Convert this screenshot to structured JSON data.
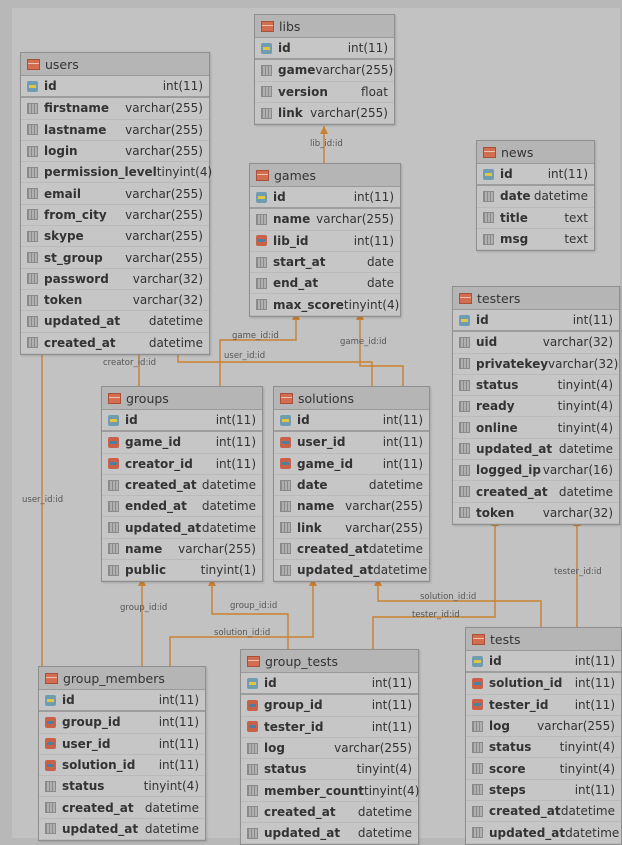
{
  "tables": [
    {
      "id": "users",
      "name": "users",
      "columns": [
        {
          "name": "id",
          "type": "int(11)",
          "key": "pk"
        },
        {
          "name": "firstname",
          "type": "varchar(255)",
          "key": ""
        },
        {
          "name": "lastname",
          "type": "varchar(255)",
          "key": ""
        },
        {
          "name": "login",
          "type": "varchar(255)",
          "key": ""
        },
        {
          "name": "permission_level",
          "type": "tinyint(4)",
          "key": ""
        },
        {
          "name": "email",
          "type": "varchar(255)",
          "key": ""
        },
        {
          "name": "from_city",
          "type": "varchar(255)",
          "key": ""
        },
        {
          "name": "skype",
          "type": "varchar(255)",
          "key": ""
        },
        {
          "name": "st_group",
          "type": "varchar(255)",
          "key": ""
        },
        {
          "name": "password",
          "type": "varchar(32)",
          "key": ""
        },
        {
          "name": "token",
          "type": "varchar(32)",
          "key": ""
        },
        {
          "name": "updated_at",
          "type": "datetime",
          "key": ""
        },
        {
          "name": "created_at",
          "type": "datetime",
          "key": ""
        }
      ]
    },
    {
      "id": "libs",
      "name": "libs",
      "columns": [
        {
          "name": "id",
          "type": "int(11)",
          "key": "pk"
        },
        {
          "name": "game",
          "type": "varchar(255)",
          "key": ""
        },
        {
          "name": "version",
          "type": "float",
          "key": ""
        },
        {
          "name": "link",
          "type": "varchar(255)",
          "key": ""
        }
      ]
    },
    {
      "id": "news",
      "name": "news",
      "columns": [
        {
          "name": "id",
          "type": "int(11)",
          "key": "pk"
        },
        {
          "name": "date",
          "type": "datetime",
          "key": ""
        },
        {
          "name": "title",
          "type": "text",
          "key": ""
        },
        {
          "name": "msg",
          "type": "text",
          "key": ""
        }
      ]
    },
    {
      "id": "games",
      "name": "games",
      "columns": [
        {
          "name": "id",
          "type": "int(11)",
          "key": "pk"
        },
        {
          "name": "name",
          "type": "varchar(255)",
          "key": ""
        },
        {
          "name": "lib_id",
          "type": "int(11)",
          "key": "fk"
        },
        {
          "name": "start_at",
          "type": "date",
          "key": ""
        },
        {
          "name": "end_at",
          "type": "date",
          "key": ""
        },
        {
          "name": "max_score",
          "type": "tinyint(4)",
          "key": ""
        }
      ]
    },
    {
      "id": "testers",
      "name": "testers",
      "columns": [
        {
          "name": "id",
          "type": "int(11)",
          "key": "pk"
        },
        {
          "name": "uid",
          "type": "varchar(32)",
          "key": ""
        },
        {
          "name": "privatekey",
          "type": "varchar(32)",
          "key": ""
        },
        {
          "name": "status",
          "type": "tinyint(4)",
          "key": ""
        },
        {
          "name": "ready",
          "type": "tinyint(4)",
          "key": ""
        },
        {
          "name": "online",
          "type": "tinyint(4)",
          "key": ""
        },
        {
          "name": "updated_at",
          "type": "datetime",
          "key": ""
        },
        {
          "name": "logged_ip",
          "type": "varchar(16)",
          "key": ""
        },
        {
          "name": "created_at",
          "type": "datetime",
          "key": ""
        },
        {
          "name": "token",
          "type": "varchar(32)",
          "key": ""
        }
      ]
    },
    {
      "id": "groups",
      "name": "groups",
      "columns": [
        {
          "name": "id",
          "type": "int(11)",
          "key": "pk"
        },
        {
          "name": "game_id",
          "type": "int(11)",
          "key": "fk"
        },
        {
          "name": "creator_id",
          "type": "int(11)",
          "key": "fk"
        },
        {
          "name": "created_at",
          "type": "datetime",
          "key": ""
        },
        {
          "name": "ended_at",
          "type": "datetime",
          "key": ""
        },
        {
          "name": "updated_at",
          "type": "datetime",
          "key": ""
        },
        {
          "name": "name",
          "type": "varchar(255)",
          "key": ""
        },
        {
          "name": "public",
          "type": "tinyint(1)",
          "key": ""
        }
      ]
    },
    {
      "id": "solutions",
      "name": "solutions",
      "columns": [
        {
          "name": "id",
          "type": "int(11)",
          "key": "pk"
        },
        {
          "name": "user_id",
          "type": "int(11)",
          "key": "fk"
        },
        {
          "name": "game_id",
          "type": "int(11)",
          "key": "fk"
        },
        {
          "name": "date",
          "type": "datetime",
          "key": ""
        },
        {
          "name": "name",
          "type": "varchar(255)",
          "key": ""
        },
        {
          "name": "link",
          "type": "varchar(255)",
          "key": ""
        },
        {
          "name": "created_at",
          "type": "datetime",
          "key": ""
        },
        {
          "name": "updated_at",
          "type": "datetime",
          "key": ""
        }
      ]
    },
    {
      "id": "group_members",
      "name": "group_members",
      "columns": [
        {
          "name": "id",
          "type": "int(11)",
          "key": "pk"
        },
        {
          "name": "group_id",
          "type": "int(11)",
          "key": "fk"
        },
        {
          "name": "user_id",
          "type": "int(11)",
          "key": "fk"
        },
        {
          "name": "solution_id",
          "type": "int(11)",
          "key": "fk"
        },
        {
          "name": "status",
          "type": "tinyint(4)",
          "key": ""
        },
        {
          "name": "created_at",
          "type": "datetime",
          "key": ""
        },
        {
          "name": "updated_at",
          "type": "datetime",
          "key": ""
        }
      ]
    },
    {
      "id": "group_tests",
      "name": "group_tests",
      "columns": [
        {
          "name": "id",
          "type": "int(11)",
          "key": "pk"
        },
        {
          "name": "group_id",
          "type": "int(11)",
          "key": "fk"
        },
        {
          "name": "tester_id",
          "type": "int(11)",
          "key": "fk"
        },
        {
          "name": "log",
          "type": "varchar(255)",
          "key": ""
        },
        {
          "name": "status",
          "type": "tinyint(4)",
          "key": ""
        },
        {
          "name": "member_count",
          "type": "tinyint(4)",
          "key": ""
        },
        {
          "name": "created_at",
          "type": "datetime",
          "key": ""
        },
        {
          "name": "updated_at",
          "type": "datetime",
          "key": ""
        }
      ]
    },
    {
      "id": "tests",
      "name": "tests",
      "columns": [
        {
          "name": "id",
          "type": "int(11)",
          "key": "pk"
        },
        {
          "name": "solution_id",
          "type": "int(11)",
          "key": "fk"
        },
        {
          "name": "tester_id",
          "type": "int(11)",
          "key": "fk"
        },
        {
          "name": "log",
          "type": "varchar(255)",
          "key": ""
        },
        {
          "name": "status",
          "type": "tinyint(4)",
          "key": ""
        },
        {
          "name": "score",
          "type": "tinyint(4)",
          "key": ""
        },
        {
          "name": "steps",
          "type": "int(11)",
          "key": ""
        },
        {
          "name": "created_at",
          "type": "datetime",
          "key": ""
        },
        {
          "name": "updated_at",
          "type": "datetime",
          "key": ""
        }
      ]
    }
  ],
  "relations": [
    {
      "id": "r-lib",
      "label": "lib_id:id"
    },
    {
      "id": "r-creator",
      "label": "creator_id:id"
    },
    {
      "id": "r-game-groups",
      "label": "game_id:id"
    },
    {
      "id": "r-user-solutions",
      "label": "user_id:id"
    },
    {
      "id": "r-game-solutions",
      "label": "game_id:id"
    },
    {
      "id": "r-user-members",
      "label": "user_id:id"
    },
    {
      "id": "r-group-members",
      "label": "group_id:id"
    },
    {
      "id": "r-group-tests",
      "label": "group_id:id"
    },
    {
      "id": "r-solution-members",
      "label": "solution_id:id"
    },
    {
      "id": "r-solution-tests",
      "label": "solution_id:id"
    },
    {
      "id": "r-tester-grouptests",
      "label": "tester_id:id"
    },
    {
      "id": "r-tester-tests",
      "label": "tester_id:id"
    }
  ],
  "colors": {
    "connector": "#c9812f",
    "background": "#c2c2c2"
  }
}
